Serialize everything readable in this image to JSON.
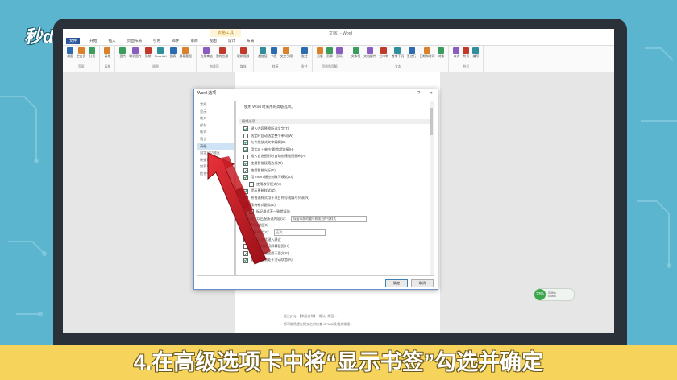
{
  "logo": {
    "text": "秒dong视频"
  },
  "word": {
    "contextual_tab": "表格工具",
    "doc_title": "文档1 - Word",
    "tabs": [
      "文件",
      "开始",
      "插入",
      "页面布局",
      "引用",
      "邮件",
      "审阅",
      "视图",
      "设计",
      "布局"
    ],
    "ribbon_groups": [
      {
        "label": "页面",
        "buttons": [
          "封面",
          "空白页",
          "分页"
        ]
      },
      {
        "label": "表格",
        "buttons": [
          "表格"
        ]
      },
      {
        "label": "插图",
        "buttons": [
          "图片",
          "联机图片",
          "形状",
          "SmartArt",
          "图表",
          "屏幕截图"
        ]
      },
      {
        "label": "加载项",
        "buttons": [
          "应用商店",
          "我的应用"
        ]
      },
      {
        "label": "媒体",
        "buttons": [
          "联机视频"
        ]
      },
      {
        "label": "链接",
        "buttons": [
          "超链接",
          "书签",
          "交叉引用"
        ]
      },
      {
        "label": "批注",
        "buttons": [
          "批注"
        ]
      },
      {
        "label": "页眉和页脚",
        "buttons": [
          "页眉",
          "页脚",
          "页码"
        ]
      },
      {
        "label": "文本",
        "buttons": [
          "文本框",
          "文档部件",
          "艺术字",
          "首字下沉",
          "签名行",
          "日期和时间",
          "对象"
        ]
      },
      {
        "label": "符号",
        "buttons": [
          "公式",
          "符号",
          "编号"
        ]
      }
    ]
  },
  "comments": [
    "批注[P4]: 【字段名称】 “确认” 按钮...",
    "您可能希望在提交之前检查 GPA 以及相关课程..."
  ],
  "dialog": {
    "title": "Word 选项",
    "help": "?",
    "close": "✕",
    "nav": [
      "常规",
      "显示",
      "校对",
      "保存",
      "版式",
      "语言",
      "高级",
      "自定义功能区",
      "快速访问工具栏",
      "加载项",
      "信任中心"
    ],
    "selected_nav": "高级",
    "heading": "使用 Word 时采用的高级选项。",
    "section": "编辑选项",
    "options": [
      {
        "label": "键入内容替换所选文字(T)",
        "checked": true,
        "indent": false
      },
      {
        "label": "选定时自动选定整个单词(W)",
        "checked": false,
        "indent": false
      },
      {
        "label": "允许拖放式文字编辑(D)",
        "checked": true,
        "indent": false
      },
      {
        "label": "用“Ctrl + 单击”跟踪超链接(H)",
        "checked": true,
        "indent": false
      },
      {
        "label": "插入自选图形时自动创建绘图画布(A)",
        "checked": false,
        "indent": false
      },
      {
        "label": "使用智能段落选择(M)",
        "checked": true,
        "indent": false
      },
      {
        "label": "使用智能光标(E)",
        "checked": true,
        "indent": false
      },
      {
        "label": "用 Insert 键控制改写模式(O)",
        "checked": true,
        "indent": false
      },
      {
        "label": "使用改写模式(V)",
        "checked": false,
        "indent": true
      },
      {
        "label": "提示更新样式(Z)",
        "checked": true,
        "indent": false
      },
      {
        "label": "将普通样式用于项目符号或编号列表(N)",
        "checked": false,
        "indent": false
      },
      {
        "label": "保持格式跟踪(E)",
        "checked": true,
        "indent": false
      },
      {
        "label": "标记格式不一致错误(I)",
        "checked": false,
        "indent": true
      },
      {
        "label": "更新样式以匹配所选内容(U):",
        "checked": null,
        "indent": false,
        "select": "保留以前的编号和项目符号样式"
      },
      {
        "label": "粘贴选项按钮(C)",
        "checked": null,
        "indent": false
      },
      {
        "label": "默认段落样式(Y):",
        "checked": null,
        "indent": false,
        "select": "正文"
      },
      {
        "label": "显示记忆式键入建议",
        "checked": true,
        "indent": false
      },
      {
        "label": "不自动超链接屏幕截图(H)",
        "checked": false,
        "indent": false
      },
      {
        "label": "中文字体也应用于西文(F)",
        "checked": true,
        "indent": false
      },
      {
        "label": "输入法控制处于活动状态(A)",
        "checked": true,
        "indent": false
      }
    ],
    "ok": "确定",
    "cancel": "取消"
  },
  "net_badge": {
    "percent": "23%",
    "up": "0.3K/s",
    "down": "0.4K/s"
  },
  "caption": "4.在高级选项卡中将“显示书签”勾选并确定"
}
